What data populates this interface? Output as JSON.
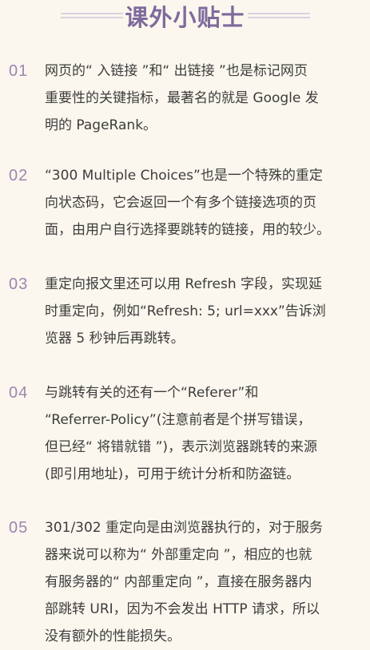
{
  "title": "课外小贴士",
  "tips": [
    {
      "number": "01",
      "lines": [
        "网页的“ 入链接 ”和“ 出链接 ”也是标记网页",
        "重要性的关键指标，最著名的就是 Google 发",
        "明的 PageRank。"
      ]
    },
    {
      "number": "02",
      "lines": [
        "“300 Multiple Choices”也是一个特殊的重定",
        "向状态码，它会返回一个有多个链接选项的页",
        "面，由用户自行选择要跳转的链接，用的较少。"
      ]
    },
    {
      "number": "03",
      "lines": [
        "重定向报文里还可以用 Refresh 字段，实现延",
        "时重定向，例如“Refresh: 5; url=xxx”告诉浏",
        "览器 5 秒钟后再跳转。"
      ]
    },
    {
      "number": "04",
      "lines": [
        "与跳转有关的还有一个“Referer”和",
        "“Referrer-Policy”(注意前者是个拼写错误，",
        "但已经“ 将错就错 ”)，表示浏览器跳转的来源",
        "(即引用地址)，可用于统计分析和防盗链。"
      ]
    },
    {
      "number": "05",
      "lines": [
        "301/302 重定向是由浏览器执行的，对于服务",
        "器来说可以称为“ 外部重定向 ”，相应的也就",
        "有服务器的“ 内部重定向 ”，直接在服务器内",
        "部跳转 URI，因为不会发出 HTTP 请求，所以",
        "没有额外的性能损失。"
      ]
    }
  ]
}
